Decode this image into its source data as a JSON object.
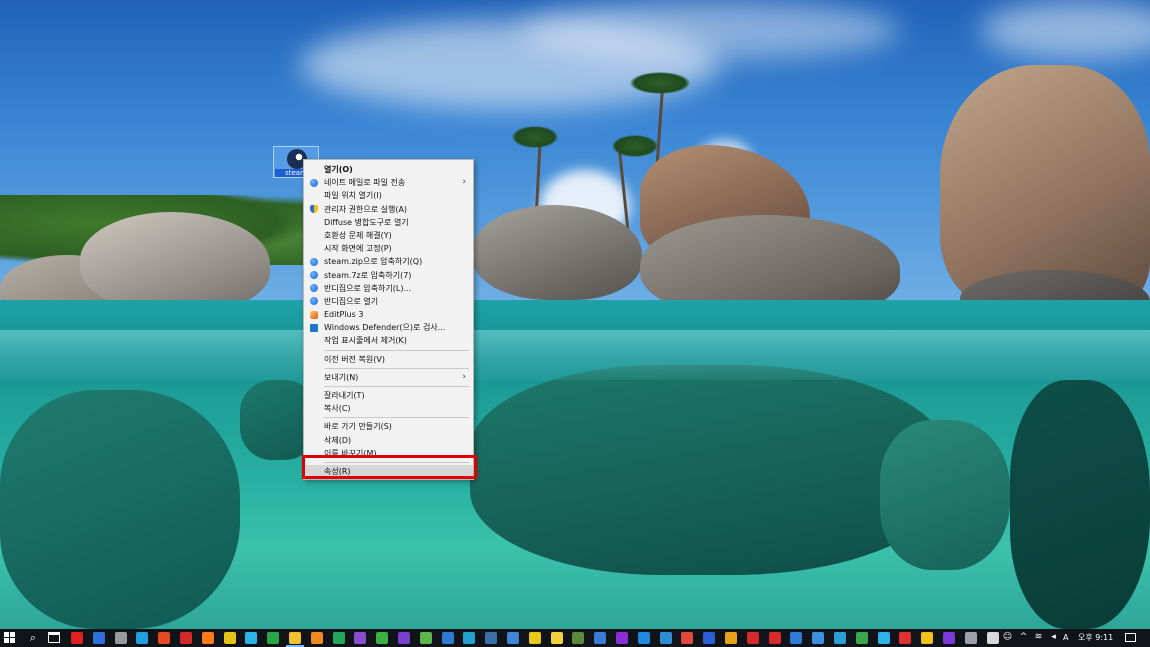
{
  "desktop": {
    "icon_label": "steam"
  },
  "context_menu": {
    "items": [
      {
        "label": "열기(O)",
        "bold": true
      },
      {
        "label": "네이트 메일로 파일 전송",
        "icon": "blue-ball",
        "submenu": true
      },
      {
        "label": "파일 위치 열기(I)"
      },
      {
        "label": "관리자 권한으로 실행(A)",
        "icon": "shield"
      },
      {
        "label": "Diffuse 병합도구로 열기"
      },
      {
        "label": "호환성 문제 해결(Y)"
      },
      {
        "label": "시작 화면에 고정(P)"
      },
      {
        "label": "steam.zip으로 압축하기(Q)",
        "icon": "blue-ball"
      },
      {
        "label": "steam.7z로 압축하기(7)",
        "icon": "blue-ball"
      },
      {
        "label": "반디집으로 압축하기(L)...",
        "icon": "blue-ball"
      },
      {
        "label": "반디집으로 열기",
        "icon": "blue-ball"
      },
      {
        "label": "EditPlus 3",
        "icon": "editplus"
      },
      {
        "label": "Windows Defender(으)로 검사...",
        "icon": "defender"
      },
      {
        "label": "작업 표시줄에서 제거(K)"
      },
      {
        "label": "이전 버전 복원(V)"
      },
      {
        "label": "보내기(N)",
        "submenu": true
      },
      {
        "label": "잘라내기(T)"
      },
      {
        "label": "복사(C)"
      },
      {
        "label": "바로 가기 만들기(S)"
      },
      {
        "label": "삭제(D)"
      },
      {
        "label": "이름 바꾸기(M)"
      },
      {
        "label": "속성(R)",
        "highlighted": true
      }
    ]
  },
  "taskbar": {
    "start_icon": "windows-logo-icon",
    "search_icon": "search-icon",
    "task_view_icon": "task-view-icon",
    "apps": [
      {
        "name": "app-1",
        "color": "#e02020"
      },
      {
        "name": "app-2",
        "color": "#2f6fdc"
      },
      {
        "name": "app-3",
        "color": "#9a9a9a"
      },
      {
        "name": "edge",
        "color": "#1fa0e0"
      },
      {
        "name": "app-5",
        "color": "#e84a1f"
      },
      {
        "name": "app-6",
        "color": "#d42a2a"
      },
      {
        "name": "firefox",
        "color": "#ff7a1a"
      },
      {
        "name": "chrome",
        "color": "#e7c21a"
      },
      {
        "name": "app-9",
        "color": "#2db3e8"
      },
      {
        "name": "app-10",
        "color": "#27a844"
      },
      {
        "name": "file-explorer",
        "color": "#f0c030",
        "active": true
      },
      {
        "name": "app-12",
        "color": "#f08a24"
      },
      {
        "name": "app-13",
        "color": "#23a55a"
      },
      {
        "name": "app-14",
        "color": "#8a4fd1"
      },
      {
        "name": "app-15",
        "color": "#3cb043"
      },
      {
        "name": "visual-studio",
        "color": "#7b3fd0"
      },
      {
        "name": "app-17",
        "color": "#5db648"
      },
      {
        "name": "app-18",
        "color": "#2e7bd6"
      },
      {
        "name": "app-19",
        "color": "#24a0d0"
      },
      {
        "name": "steam",
        "color": "#3a6fa8"
      },
      {
        "name": "app-21",
        "color": "#3d86d8"
      },
      {
        "name": "app-22",
        "color": "#e8c81a"
      },
      {
        "name": "app-23",
        "color": "#f2d23a"
      },
      {
        "name": "app-24",
        "color": "#5a8a3a"
      },
      {
        "name": "app-25",
        "color": "#3c7bd6"
      },
      {
        "name": "app-26",
        "color": "#8a2fd8"
      },
      {
        "name": "photoshop",
        "color": "#1f8ae0"
      },
      {
        "name": "app-28",
        "color": "#2b8ed6"
      },
      {
        "name": "app-29",
        "color": "#e04a3a"
      },
      {
        "name": "word",
        "color": "#2b5fd6"
      },
      {
        "name": "app-31",
        "color": "#e8a21a"
      },
      {
        "name": "app-32",
        "color": "#d42a2a"
      },
      {
        "name": "filezilla",
        "color": "#d82a2a"
      },
      {
        "name": "app-34",
        "color": "#2e7bd6"
      },
      {
        "name": "app-35",
        "color": "#3a8fe0"
      },
      {
        "name": "app-36",
        "color": "#2aa0d8"
      },
      {
        "name": "app-37",
        "color": "#3aa84a"
      },
      {
        "name": "app-38",
        "color": "#2db3e8"
      },
      {
        "name": "app-39",
        "color": "#e03030"
      },
      {
        "name": "app-40",
        "color": "#f2c21a"
      },
      {
        "name": "app-41",
        "color": "#7a3ad8"
      },
      {
        "name": "app-42",
        "color": "#9aa0a8"
      },
      {
        "name": "app-43",
        "color": "#d8d8d8"
      }
    ],
    "tray": {
      "ime_label": "A",
      "clock": "오후 9:11"
    }
  }
}
